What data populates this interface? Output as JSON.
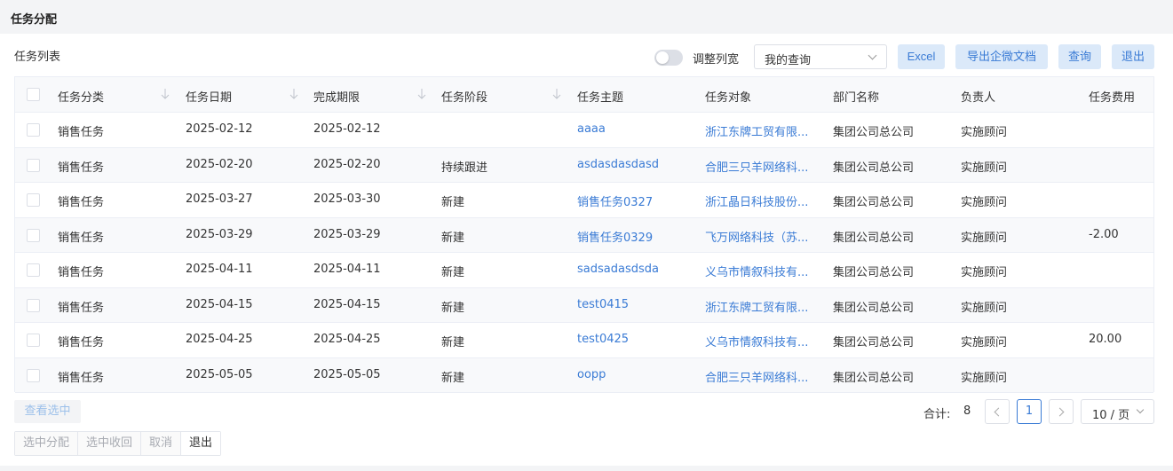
{
  "page": {
    "title": "任务分配"
  },
  "section": {
    "title": "任务列表"
  },
  "toolbar": {
    "toggle_label": "调整列宽",
    "query_select_value": "我的查询",
    "excel_label": "Excel",
    "export_label": "导出企微文档",
    "query_label": "查询",
    "exit_label": "退出"
  },
  "table": {
    "headers": [
      "任务分类",
      "任务日期",
      "完成期限",
      "任务阶段",
      "任务主题",
      "任务对象",
      "部门名称",
      "负责人",
      "任务费用"
    ],
    "rows": [
      [
        "销售任务",
        "2025-02-12",
        "2025-02-12",
        "",
        "aaaa",
        "浙江东牌工贸有限...",
        "集团公司总公司",
        "实施顾问",
        ""
      ],
      [
        "销售任务",
        "2025-02-20",
        "2025-02-20",
        "持续跟进",
        "asdasdasdasd",
        "合肥三只羊网络科...",
        "集团公司总公司",
        "实施顾问",
        ""
      ],
      [
        "销售任务",
        "2025-03-27",
        "2025-03-30",
        "新建",
        "销售任务0327",
        "浙江晶日科技股份...",
        "集团公司总公司",
        "实施顾问",
        ""
      ],
      [
        "销售任务",
        "2025-03-29",
        "2025-03-29",
        "新建",
        "销售任务0329",
        "飞万网络科技（苏...",
        "集团公司总公司",
        "实施顾问",
        "-2.00"
      ],
      [
        "销售任务",
        "2025-04-11",
        "2025-04-11",
        "新建",
        "sadsadasdsda",
        "义乌市情叙科技有...",
        "集团公司总公司",
        "实施顾问",
        ""
      ],
      [
        "销售任务",
        "2025-04-15",
        "2025-04-15",
        "新建",
        "test0415",
        "浙江东牌工贸有限...",
        "集团公司总公司",
        "实施顾问",
        ""
      ],
      [
        "销售任务",
        "2025-04-25",
        "2025-04-25",
        "新建",
        "test0425",
        "义乌市情叙科技有...",
        "集团公司总公司",
        "实施顾问",
        "20.00"
      ],
      [
        "销售任务",
        "2025-05-05",
        "2025-05-05",
        "新建",
        "oopp",
        "合肥三只羊网络科...",
        "集团公司总公司",
        "实施顾问",
        ""
      ]
    ]
  },
  "footer": {
    "view_selected_label": "查看选中",
    "total_label": "合计:",
    "total_value": "8",
    "current_page": "1",
    "page_size": "10 / 页",
    "actions": [
      "选中分配",
      "选中收回",
      "取消",
      "退出"
    ]
  },
  "colors": {
    "accent": "#3a7bd5",
    "button_bg": "#dbe9f9",
    "header_bg": "#f8f9fb",
    "border": "#ebeef5"
  },
  "icons": {
    "sort": "sort-down-arrow-icon",
    "select": "chevron-down-icon",
    "prev": "chevron-left-icon",
    "next": "chevron-right-icon"
  }
}
